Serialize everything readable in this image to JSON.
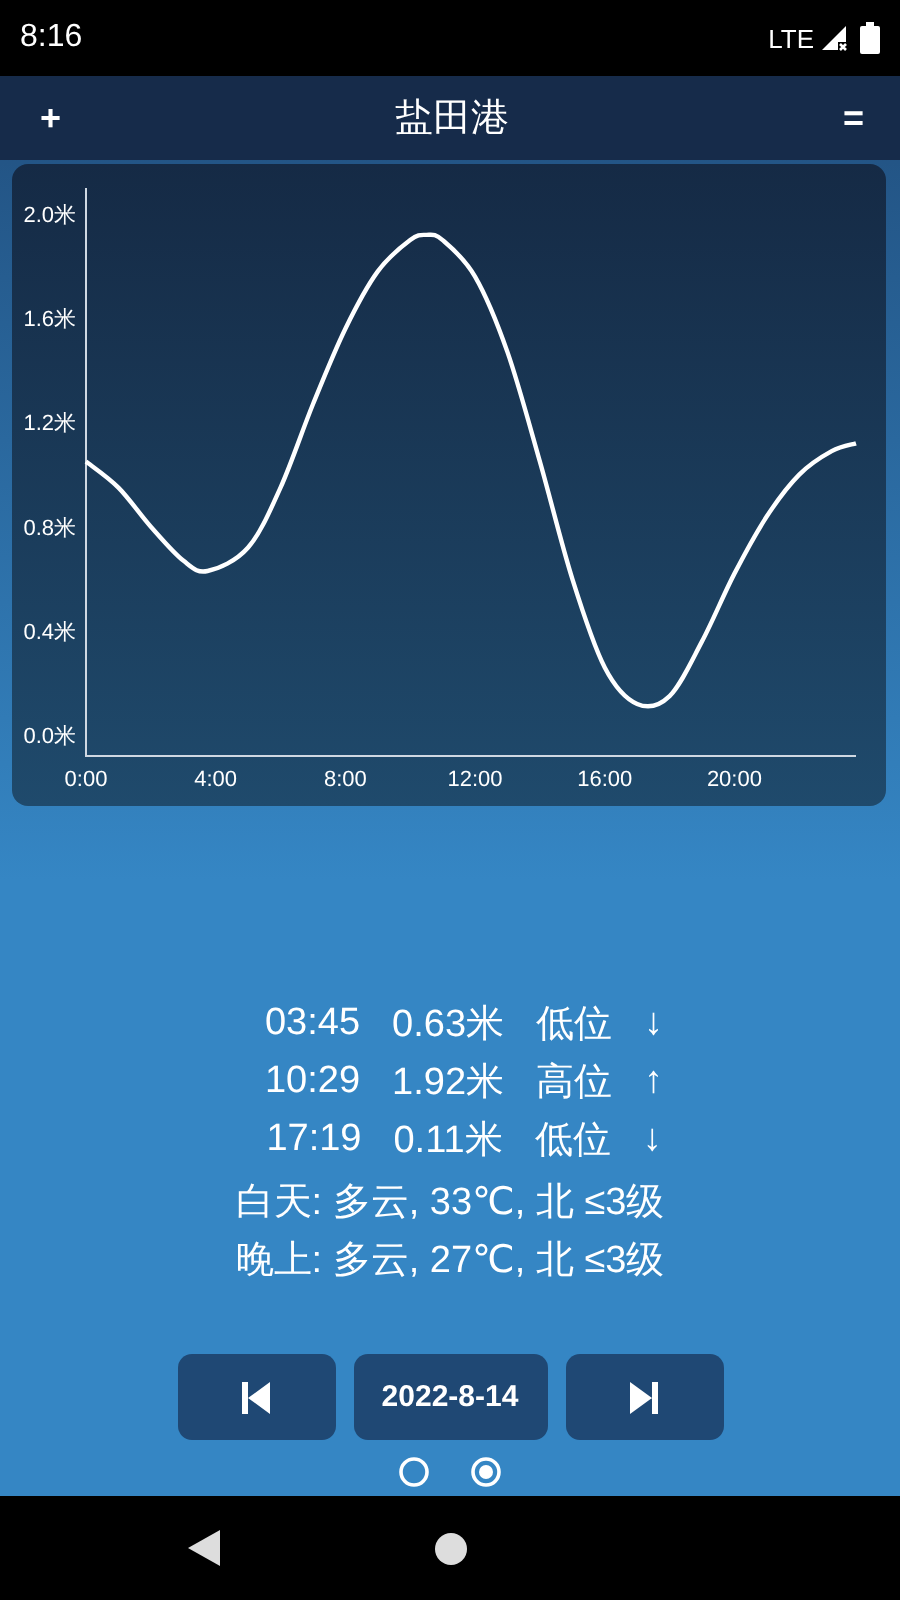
{
  "status_bar": {
    "time": "8:16",
    "network": "LTE"
  },
  "header": {
    "add": "+",
    "title": "盐田港",
    "menu": "="
  },
  "chart": {
    "chart_data": {
      "type": "line",
      "x": [
        0,
        1,
        2,
        3,
        3.75,
        5,
        6,
        7,
        8,
        9,
        10,
        10.5,
        11,
        12,
        13,
        14,
        15,
        16,
        17,
        18,
        19,
        20,
        21,
        22,
        23,
        23.75
      ],
      "series": [
        {
          "color": "#ffffff",
          "values": [
            1.05,
            0.95,
            0.8,
            0.67,
            0.63,
            0.72,
            0.95,
            1.27,
            1.56,
            1.78,
            1.9,
            1.92,
            1.9,
            1.76,
            1.47,
            1.05,
            0.6,
            0.26,
            0.12,
            0.15,
            0.36,
            0.62,
            0.84,
            1.0,
            1.09,
            1.12
          ]
        }
      ],
      "xlim": [
        0,
        23.75
      ],
      "ylim": [
        -0.08,
        2.1
      ],
      "xticks": [
        {
          "value": 0,
          "label": "0:00"
        },
        {
          "value": 4,
          "label": "4:00"
        },
        {
          "value": 8,
          "label": "8:00"
        },
        {
          "value": 12,
          "label": "12:00"
        },
        {
          "value": 16,
          "label": "16:00"
        },
        {
          "value": 20,
          "label": "20:00"
        }
      ],
      "yticks": [
        {
          "value": 0,
          "label": "0.0米"
        },
        {
          "value": 0.4,
          "label": "0.4米"
        },
        {
          "value": 0.8,
          "label": "0.8米"
        },
        {
          "value": 1.2,
          "label": "1.2米"
        },
        {
          "value": 1.6,
          "label": "1.6米"
        },
        {
          "value": 2.0,
          "label": "2.0米"
        }
      ]
    }
  },
  "tides": [
    {
      "time": "03:45",
      "height": "0.63米",
      "type": "低位",
      "arrow": "↓"
    },
    {
      "time": "10:29",
      "height": "1.92米",
      "type": "高位",
      "arrow": "↑"
    },
    {
      "time": "17:19",
      "height": "0.11米",
      "type": "低位",
      "arrow": "↓"
    }
  ],
  "weather": [
    "白天: 多云, 33℃, 北 ≤3级",
    "晚上: 多云, 27℃, 北 ≤3级"
  ],
  "date_nav": {
    "date": "2022-8-14"
  },
  "pages": [
    {
      "selected": false
    },
    {
      "selected": true
    }
  ]
}
